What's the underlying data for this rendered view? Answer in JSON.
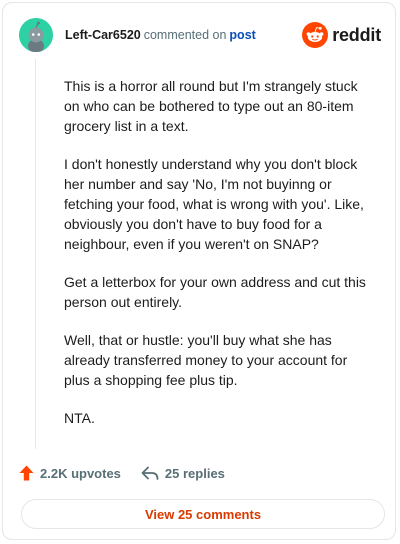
{
  "header": {
    "username": "Left-Car6520",
    "action_text": "commented on",
    "post_link": "post",
    "brand_name": "reddit"
  },
  "comment": {
    "paragraphs": [
      "This is a horror all round but I'm strangely stuck on who can be bothered to type out an 80-item grocery list in a text.",
      "I don't honestly understand why you don't block her number and say 'No, I'm not buyinng or fetching your food, what is wrong with you'. Like, obviously you don't have to buy food for a neighbour, even if you weren't on SNAP?",
      "Get a letterbox for your own address and cut this person out entirely.",
      "Well, that or hustle: you'll buy what she has already transferred money to your account for plus a shopping fee plus tip.",
      "NTA."
    ]
  },
  "actions": {
    "upvotes": "2.2K upvotes",
    "replies": "25 replies"
  },
  "footer": {
    "view_comments": "View 25 comments"
  },
  "colors": {
    "accent": "#ff4500",
    "avatar_bg": "#2dd1a4",
    "link": "#0a4fb8",
    "view_button_text": "#d93a00"
  },
  "icons": {
    "avatar": "snoo-avatar-icon",
    "brand": "reddit-logo-icon",
    "upvote": "upvote-arrow-icon",
    "reply": "reply-arrow-icon"
  }
}
